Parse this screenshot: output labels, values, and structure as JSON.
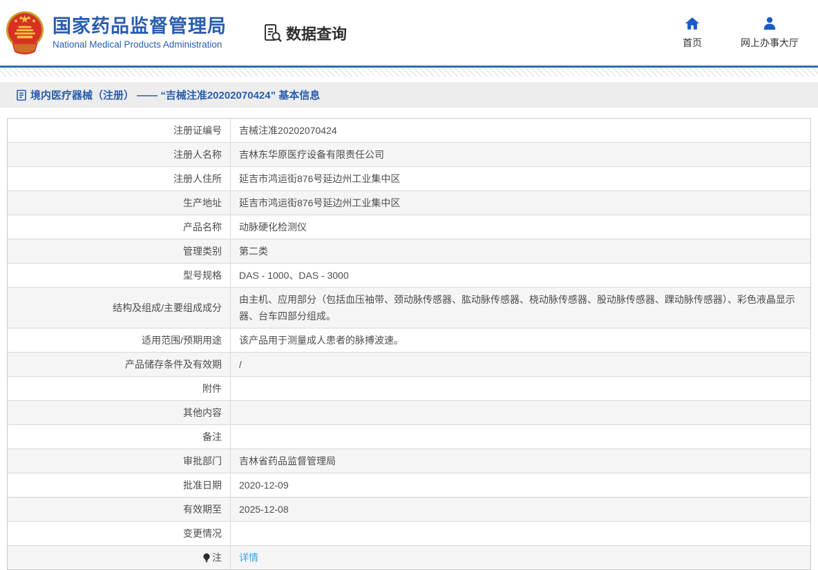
{
  "header": {
    "org_name_cn": "国家药品监督管理局",
    "org_name_en": "National Medical Products Administration",
    "query_label": "数据查询",
    "nav": [
      {
        "label": "首页",
        "icon": "home-icon"
      },
      {
        "label": "网上办事大厅",
        "icon": "person-icon"
      }
    ]
  },
  "breadcrumb": {
    "text": "境内医疗器械（注册） —— “吉械注准20202070424” 基本信息"
  },
  "colors": {
    "brand_blue": "#2a5dae",
    "icon_blue": "#1a5bc8",
    "divider_blue": "#2e6fb0",
    "link_blue": "#42a0dd",
    "breadcrumb_bg": "#ededee",
    "row_alt_bg": "#f5f5f6"
  },
  "table": {
    "rows": [
      {
        "label": "注册证编号",
        "value": "吉械注准20202070424"
      },
      {
        "label": "注册人名称",
        "value": "吉林东华原医疗设备有限责任公司"
      },
      {
        "label": "注册人住所",
        "value": "延吉市鸿运街876号延边州工业集中区"
      },
      {
        "label": "生产地址",
        "value": "延吉市鸿运街876号延边州工业集中区"
      },
      {
        "label": "产品名称",
        "value": "动脉硬化检测仪"
      },
      {
        "label": "管理类别",
        "value": "第二类"
      },
      {
        "label": "型号规格",
        "value": "DAS - 1000、DAS - 3000"
      },
      {
        "label": "结构及组成/主要组成成分",
        "value": "由主机、应用部分（包括血压袖带、颈动脉传感器、肱动脉传感器、桡动脉传感器、股动脉传感器、踝动脉传感器）、彩色液晶显示器、台车四部分组成。"
      },
      {
        "label": "适用范围/预期用途",
        "value": "该产品用于测量成人患者的脉搏波速。"
      },
      {
        "label": "产品储存条件及有效期",
        "value": "/"
      },
      {
        "label": "附件",
        "value": ""
      },
      {
        "label": "其他内容",
        "value": ""
      },
      {
        "label": "备注",
        "value": ""
      },
      {
        "label": "审批部门",
        "value": "吉林省药品监督管理局"
      },
      {
        "label": "批准日期",
        "value": "2020-12-09"
      },
      {
        "label": "有效期至",
        "value": "2025-12-08"
      },
      {
        "label": "变更情况",
        "value": ""
      },
      {
        "label": "注",
        "label_icon": "bulb-icon",
        "value": "详情",
        "link": true
      }
    ]
  }
}
